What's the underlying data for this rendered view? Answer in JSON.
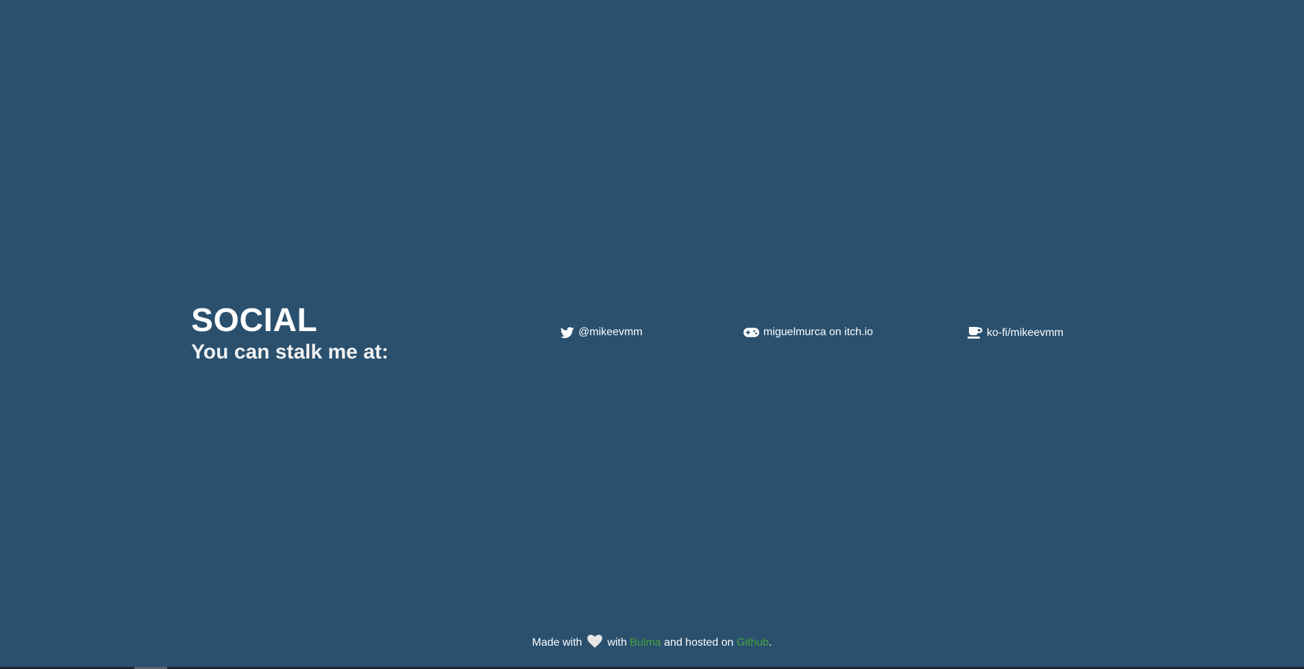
{
  "section": {
    "title": "SOCIAL",
    "subtitle": "You can stalk me at:"
  },
  "links": [
    {
      "icon": "twitter-icon",
      "label": "@mikeevmm"
    },
    {
      "icon": "gamepad-icon",
      "label": "miguelmurca on itch.io"
    },
    {
      "icon": "coffee-cup-icon",
      "label": "ko-fi/mikeevmm"
    }
  ],
  "footer": {
    "made_with": "Made with",
    "with": "with",
    "bulma": "Bulma",
    "hosted_on": "and hosted on",
    "github": "Github",
    "period": "."
  },
  "colors": {
    "background": "#2a506e",
    "text": "#ffffff",
    "link_accent": "#48a23d"
  }
}
